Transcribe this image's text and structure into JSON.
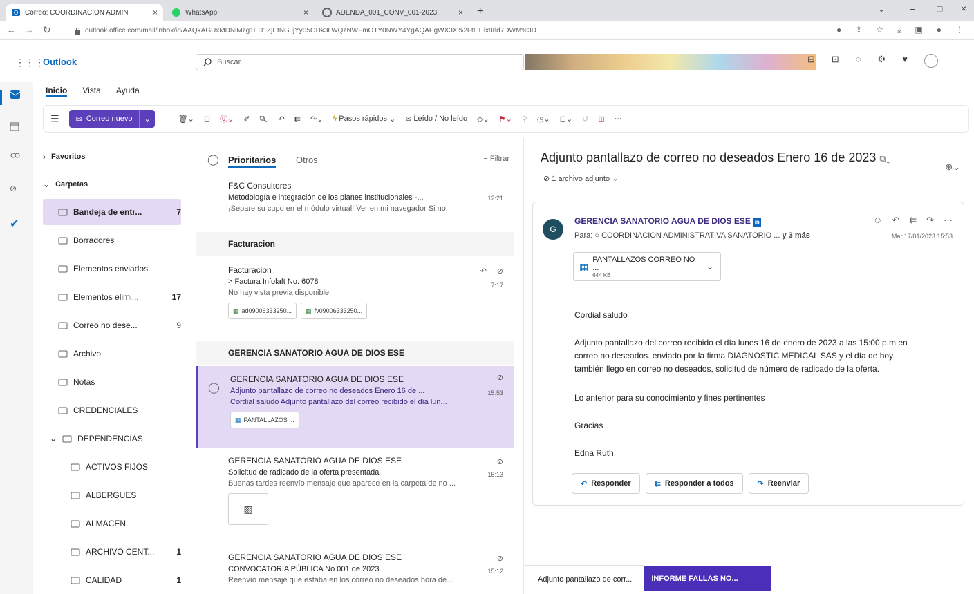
{
  "browser": {
    "tabs": [
      {
        "label": "Correo: COORDINACION ADMIN",
        "icon": "outlook-icon",
        "active": true
      },
      {
        "label": "WhatsApp",
        "icon": "whatsapp-icon",
        "active": false
      },
      {
        "label": "ADENDA_001_CONV_001-2023.",
        "icon": "chrome-page-icon",
        "active": false
      }
    ],
    "new_tab": "+",
    "url": "outlook.office.com/mail/inbox/id/AAQkAGUxMDNlMzg1LTI1ZjEtNGJjYy05ODk3LWQzNWFmOTY0NWY4YgAQAPgWX3X%2FtLlHix8rld7DWM%3D"
  },
  "outlook": {
    "brand": "Outlook",
    "search_placeholder": "Buscar"
  },
  "ribbon": {
    "tabs": [
      "Inicio",
      "Vista",
      "Ayuda"
    ],
    "new_mail": "Correo nuevo",
    "quick_steps": "Pasos rápidos",
    "read_unread": "Leído / No leído",
    "more": "···"
  },
  "folders": {
    "favorites": "Favoritos",
    "folders_label": "Carpetas",
    "items": [
      {
        "label": "Bandeja de entr...",
        "count": "7",
        "icon": "inbox-icon"
      },
      {
        "label": "Borradores",
        "count": "",
        "icon": "drafts-icon"
      },
      {
        "label": "Elementos enviados",
        "count": "",
        "icon": "sent-icon"
      },
      {
        "label": "Elementos elimi...",
        "count": "17",
        "icon": "trash-icon"
      },
      {
        "label": "Correo no dese...",
        "count": "9",
        "icon": "junk-icon"
      },
      {
        "label": "Archivo",
        "count": "",
        "icon": "archive-icon"
      },
      {
        "label": "Notas",
        "count": "",
        "icon": "notes-icon"
      },
      {
        "label": "CREDENCIALES",
        "count": "",
        "icon": "folder-icon"
      },
      {
        "label": "DEPENDENCIAS",
        "count": "",
        "icon": "folder-icon"
      },
      {
        "label": "ACTIVOS FIJOS",
        "count": "",
        "icon": "folder-icon"
      },
      {
        "label": "ALBERGUES",
        "count": "",
        "icon": "folder-icon"
      },
      {
        "label": "ALMACEN",
        "count": "",
        "icon": "folder-icon"
      },
      {
        "label": "ARCHIVO CENT...",
        "count": "1",
        "icon": "folder-icon"
      },
      {
        "label": "CALIDAD",
        "count": "1",
        "icon": "folder-icon"
      }
    ]
  },
  "list": {
    "tab_focused": "Prioritarios",
    "tab_other": "Otros",
    "filter": "Filtrar",
    "item0": {
      "from": "F&C Consultores",
      "subject": "Metodología e integración de los planes institucionales -...",
      "time": "12:21",
      "preview": "¡Separe su cupo en el módulo virtual! Ver en mi navegador Si no..."
    },
    "group1": "Facturacion",
    "item1": {
      "from": "Facturacion",
      "subject": "> Factura Infolaft No. 6078",
      "time": "7:17",
      "preview": "No hay vista previa disponible",
      "att1": "ad09006333250...",
      "att2": "fv09006333250..."
    },
    "group2": "GERENCIA SANATORIO AGUA DE DIOS ESE",
    "item2": {
      "from": "GERENCIA SANATORIO AGUA DE DIOS ESE",
      "subject": "Adjunto pantallazo de correo no deseados Enero 16 de ...",
      "time": "15:53",
      "preview": "Cordial saludo Adjunto pantallazo del correo recibido el día lun...",
      "att": "PANTALLAZOS ..."
    },
    "item3": {
      "from": "GERENCIA SANATORIO AGUA DE DIOS ESE",
      "subject": "Solicitud de radicado de la oferta presentada",
      "time": "15:13",
      "preview": "Buenas tardes reenvío mensaje que aparece en la carpeta de no ..."
    },
    "item4": {
      "from": "GERENCIA SANATORIO AGUA DE DIOS ESE",
      "subject": "CONVOCATORIA PÚBLICA No 001 de 2023",
      "time": "15:12",
      "preview": "Reenvío mensaje que estaba en los correo no deseados  hora de..."
    }
  },
  "reading": {
    "subject": "Adjunto pantallazo de correo no deseados Enero 16 de 2023",
    "attachments_count": "1 archivo adjunto",
    "avatar_letter": "G",
    "sender": "GERENCIA SANATORIO AGUA DE DIOS ESE",
    "to_prefix": "Para:",
    "to": "COORDINACION ADMINISTRATIVA SANATORIO ...",
    "more": "y 3 más",
    "date": "Mar 17/01/2023 15:53",
    "attachment_name": "PANTALLAZOS CORREO NO ...",
    "attachment_size": "644 KB",
    "body": [
      "Cordial saludo",
      "Adjunto pantallazo del correo recibido el día lunes 16 de enero de 2023 a las 15:00 p.m en",
      "correo no deseados.  enviado por la firma DIAGNOSTIC MEDICAL SAS y el día de hoy",
      "también llego en correo no deseados, solicitud de número de radicado de la oferta.",
      "Lo anterior para su conocimiento y fines pertinentes",
      "Gracias",
      "Edna Ruth"
    ],
    "reply": "Responder",
    "reply_all": "Responder a todos",
    "forward": "Reenviar"
  },
  "bottom_tabs": {
    "tab1": "Adjunto pantallazo de corr...",
    "tab2": "INFORME FALLAS NO..."
  },
  "colors": {
    "accent": "#5b3fbb",
    "selected": "#e4d9f4",
    "link_blue": "#0f6cbd"
  }
}
